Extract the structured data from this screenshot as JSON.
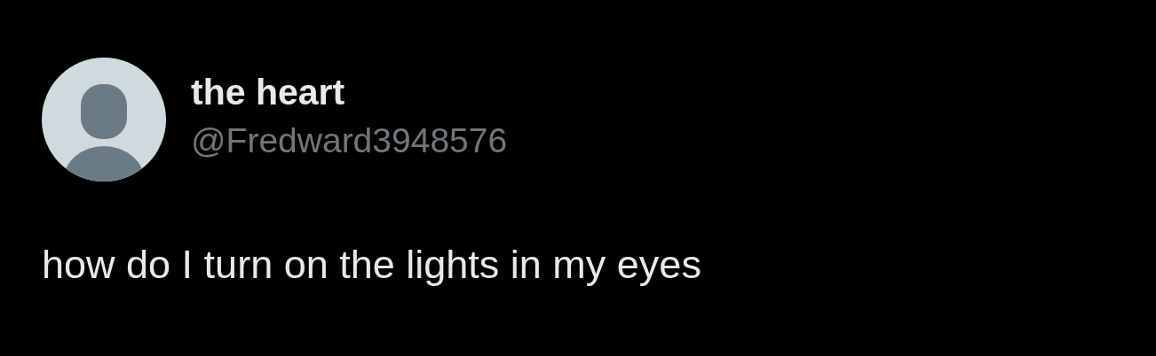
{
  "author": {
    "name": "the heart",
    "handle": "@Fredward3948576"
  },
  "post": {
    "text": "how do I turn on the lights in my eyes"
  }
}
